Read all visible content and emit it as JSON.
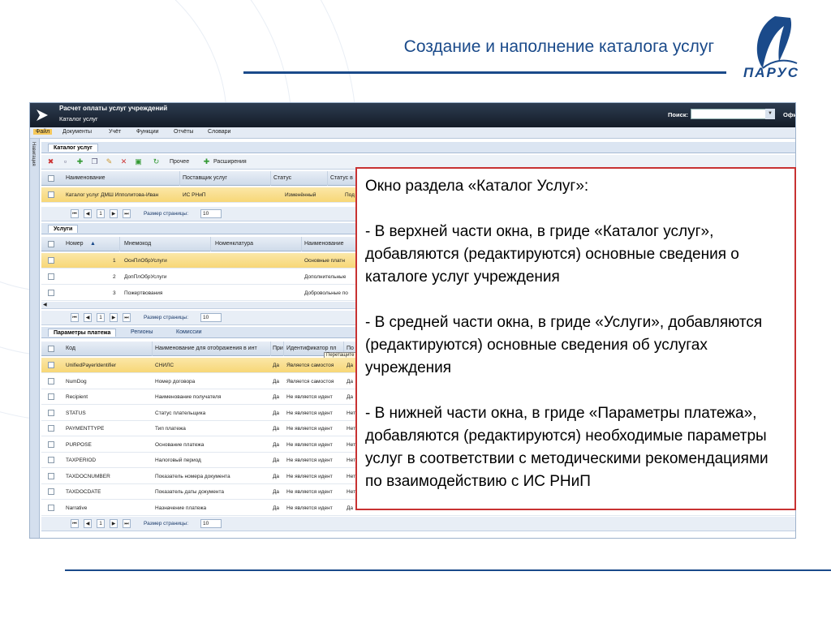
{
  "slide": {
    "title": "Создание и наполнение каталога услуг",
    "logo_text": "ПАРУС"
  },
  "app": {
    "title": "Расчет оплаты услуг учреждений",
    "subtitle": "Каталог услуг",
    "search_label": "Поиск:",
    "office_label": "Офис",
    "side_label": "Навигация",
    "menu": [
      "Файл",
      "Документы",
      "Учёт",
      "Функции",
      "Отчёты",
      "Словари"
    ],
    "main_tab": "Каталог услуг",
    "toolbar": {
      "other": "Прочее",
      "extensions": "Расширения"
    },
    "catalog_grid": {
      "headers": [
        "Наименование",
        "Поставщик услуг",
        "Статус",
        "Статус в"
      ],
      "row": [
        "Каталог услуг ДМШ Ипполитова-Иван",
        "ИС РНиП",
        "Изменённый",
        "Под"
      ]
    },
    "pager": {
      "page": "1",
      "size_label": "Размер страницы:",
      "size": "10"
    },
    "services_tab": "Услуги",
    "services_grid": {
      "headers": [
        "Номер",
        "Мнемокод",
        "Номенклатура",
        "Наименование"
      ],
      "rows": [
        [
          "1",
          "ОснПлОбрУслуги",
          "",
          "Основные платн"
        ],
        [
          "2",
          "ДопПлОбрУслуги",
          "",
          "Дополнительные"
        ],
        [
          "3",
          "Пожертвования",
          "",
          "Добровольные по"
        ]
      ]
    },
    "bottom_tabs": [
      "Параметры платежа",
      "Регионы",
      "Комиссии"
    ],
    "params_grid": {
      "headers": [
        "Код",
        "Наименование для отображения в инт",
        "При",
        "Идентификатор пл",
        "По"
      ],
      "tooltip": "Перетащите",
      "rows": [
        [
          "UnifiedPayerIdentifier",
          "СНИЛС",
          "Да",
          "Является самостоя",
          "Да"
        ],
        [
          "NumDog",
          "Номер договора",
          "Да",
          "Является самостоя",
          "Да"
        ],
        [
          "Recipient",
          "Наименование получателя",
          "Да",
          "Не является идент",
          "Да"
        ],
        [
          "STATUS",
          "Статус плательщика",
          "Да",
          "Не является идент",
          "Нет"
        ],
        [
          "PAYMENTTYPE",
          "Тип платежа",
          "Да",
          "Не является идент",
          "Нет"
        ],
        [
          "PURPOSE",
          "Основание платежа",
          "Да",
          "Не является идент",
          "Нет"
        ],
        [
          "TAXPERIOD",
          "Налоговый период",
          "Да",
          "Не является идент",
          "Нет"
        ],
        [
          "TAXDOCNUMBER",
          "Показатель номера документа",
          "Да",
          "Не является идент",
          "Нет"
        ],
        [
          "TAXDOCDATE",
          "Показатель даты документа",
          "Да",
          "Не является идент",
          "Нет"
        ],
        [
          "Narrative",
          "Назначение платежа",
          "Да",
          "Не является идент",
          "Да"
        ]
      ]
    }
  },
  "callout": {
    "heading": "Окно раздела «Каталог Услуг»:",
    "item1": "-   В верхней части окна, в гриде «Каталог услуг», добавляются (редактируются) основные сведения о каталоге услуг учреждения",
    "item2": "-   В средней части окна, в гриде «Услуги», добавляются (редактируются) основные сведения об услугах учреждения",
    "item3": "-   В нижней части окна, в гриде «Параметры платежа», добавляются (редактируются) необходимые параметры услуг в соответствии с методическими рекомендациями по взаимодействию с ИС РНиП"
  }
}
